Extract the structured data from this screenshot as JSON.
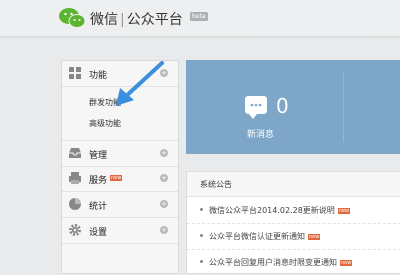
{
  "header": {
    "brand_name": "微信",
    "separator": "|",
    "platform_name": "公众平台",
    "beta_badge": "beta"
  },
  "sidebar": {
    "items": [
      {
        "label": "功能",
        "icon": "grid-icon",
        "expanded": true,
        "children": [
          {
            "label": "群发功能"
          },
          {
            "label": "高级功能"
          }
        ]
      },
      {
        "label": "管理",
        "icon": "inbox-icon"
      },
      {
        "label": "服务",
        "icon": "printer-icon",
        "badge": "new"
      },
      {
        "label": "统计",
        "icon": "pie-chart-icon"
      },
      {
        "label": "设置",
        "icon": "gear-icon"
      }
    ],
    "expand_glyph": "+"
  },
  "dashboard": {
    "new_messages_count": "0",
    "new_messages_label": "新消息",
    "accent_color": "#7ea6c9"
  },
  "notices": {
    "title": "系统公告",
    "items": [
      {
        "text": "微信公众平台2014.02.28更新说明",
        "badge": "new"
      },
      {
        "text": "公众平台微信认证更新通知",
        "badge": "new"
      },
      {
        "text": "公众平台回复用户消息时限变更通知",
        "badge": "new"
      }
    ]
  },
  "badge_color": "#e2683f"
}
